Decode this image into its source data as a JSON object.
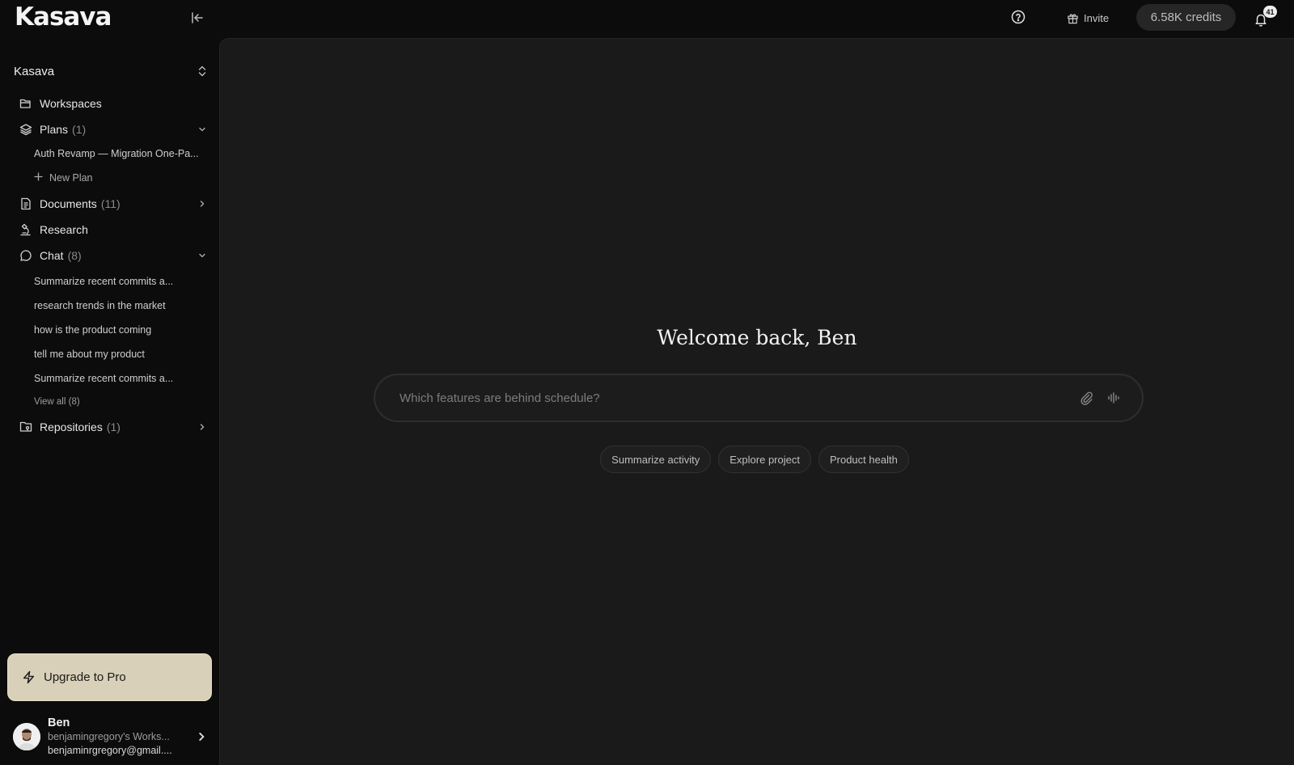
{
  "app": {
    "logo": "Kasava"
  },
  "topbar": {
    "invite_label": "Invite",
    "credits_label": "6.58K credits",
    "notifications_count": "41"
  },
  "sidebar": {
    "workspace_name": "Kasava",
    "nav": {
      "workspaces": {
        "label": "Workspaces"
      },
      "plans": {
        "label": "Plans",
        "count": "(1)",
        "items": [
          "Auth Revamp — Migration One-Pa..."
        ],
        "new_label": "New Plan"
      },
      "documents": {
        "label": "Documents",
        "count": "(11)"
      },
      "research": {
        "label": "Research"
      },
      "chat": {
        "label": "Chat",
        "count": "(8)",
        "items": [
          "Summarize recent commits a...",
          "research trends in the market",
          "how is the product coming",
          "tell me about my product",
          "Summarize recent commits a..."
        ],
        "view_all": "View all (8)"
      },
      "repositories": {
        "label": "Repositories",
        "count": "(1)"
      }
    },
    "upgrade_label": "Upgrade to Pro",
    "user": {
      "name": "Ben",
      "workspace": "benjamingregory's Works...",
      "email": "benjaminrgregory@gmail...."
    }
  },
  "main": {
    "welcome": "Welcome back, Ben",
    "prompt_placeholder": "Which features are behind schedule?",
    "suggestions": [
      "Summarize activity",
      "Explore project",
      "Product health"
    ]
  }
}
